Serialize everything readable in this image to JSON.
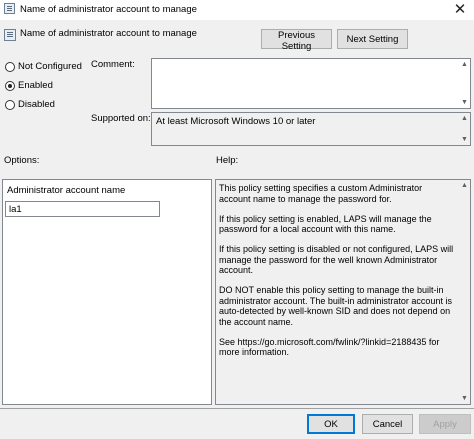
{
  "window": {
    "title": "Name of administrator account to manage",
    "close_glyph": "✕"
  },
  "header": {
    "setting_name": "Name of administrator account to manage",
    "previous_label": "Previous Setting",
    "next_label": "Next Setting"
  },
  "state": {
    "options": [
      {
        "label": "Not Configured",
        "selected": false
      },
      {
        "label": "Enabled",
        "selected": true
      },
      {
        "label": "Disabled",
        "selected": false
      }
    ]
  },
  "comment": {
    "label": "Comment:",
    "value": ""
  },
  "supported": {
    "label": "Supported on:",
    "value": "At least Microsoft Windows 10 or later"
  },
  "options_panel": {
    "heading": "Options:",
    "field_label": "Administrator account name",
    "field_value": "la1"
  },
  "help_panel": {
    "heading": "Help:",
    "paragraphs": [
      "This policy setting specifies a custom Administrator account name to manage the password for.",
      "If this policy setting is enabled, LAPS will manage the password for a local account with this name.",
      "If this policy setting is disabled or not configured, LAPS will manage the password for the well known Administrator account.",
      "DO NOT enable this policy setting to manage the built-in administrator account. The built-in administrator account is auto-detected by well-known SID and does not depend on the account name.",
      "See https://go.microsoft.com/fwlink/?linkid=2188435 for more information."
    ]
  },
  "footer": {
    "ok_label": "OK",
    "cancel_label": "Cancel",
    "apply_label": "Apply"
  },
  "icons": {
    "scroll_up": "▲",
    "scroll_down": "▼"
  },
  "colors": {
    "dialog_bg": "#f0f0f0",
    "focus_border": "#0078d7"
  }
}
